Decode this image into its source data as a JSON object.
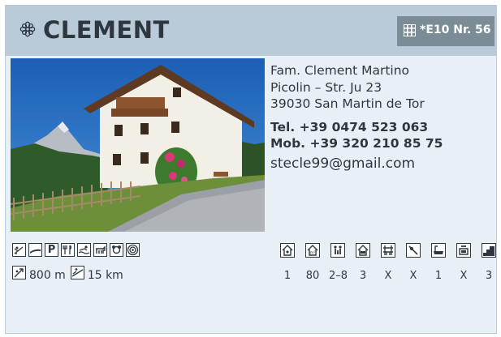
{
  "header": {
    "flower_icon": "flower-icon",
    "title": "CLEMENT",
    "code": "*E10 Nr. 56"
  },
  "photo": {
    "subject": "house-photo"
  },
  "contact": {
    "name": "Fam. Clement Martino",
    "street": "Picolin – Str. Ju 23",
    "city": "39030 San Martin de Tor",
    "tel": "Tel. +39 0474 523 063",
    "mob": "Mob. +39 320 210 85 75",
    "email": "stecle99@gmail.com"
  },
  "features": {
    "icons": [
      "ski-lift-icon",
      "ski-icon",
      "parking-icon",
      "restaurant-icon",
      "swimming-icon",
      "animals-icon",
      "playground-icon",
      "target-icon"
    ],
    "parking_letter": "P"
  },
  "distances": [
    {
      "icon": "lift-distance-icon",
      "value": "800 m"
    },
    {
      "icon": "slope-distance-icon",
      "value": "15 km"
    }
  ],
  "rooms": [
    {
      "icon": "house-icon",
      "value": "1"
    },
    {
      "icon": "area-icon",
      "value": "80"
    },
    {
      "icon": "persons-icon",
      "value": "2–8"
    },
    {
      "icon": "bedroom-icon",
      "value": "3"
    },
    {
      "icon": "balcony-icon",
      "value": "X"
    },
    {
      "icon": "garden-icon",
      "value": "X"
    },
    {
      "icon": "bath-icon",
      "value": "1"
    },
    {
      "icon": "kitchen-icon",
      "value": "X"
    },
    {
      "icon": "stairs-icon",
      "value": "3"
    }
  ]
}
